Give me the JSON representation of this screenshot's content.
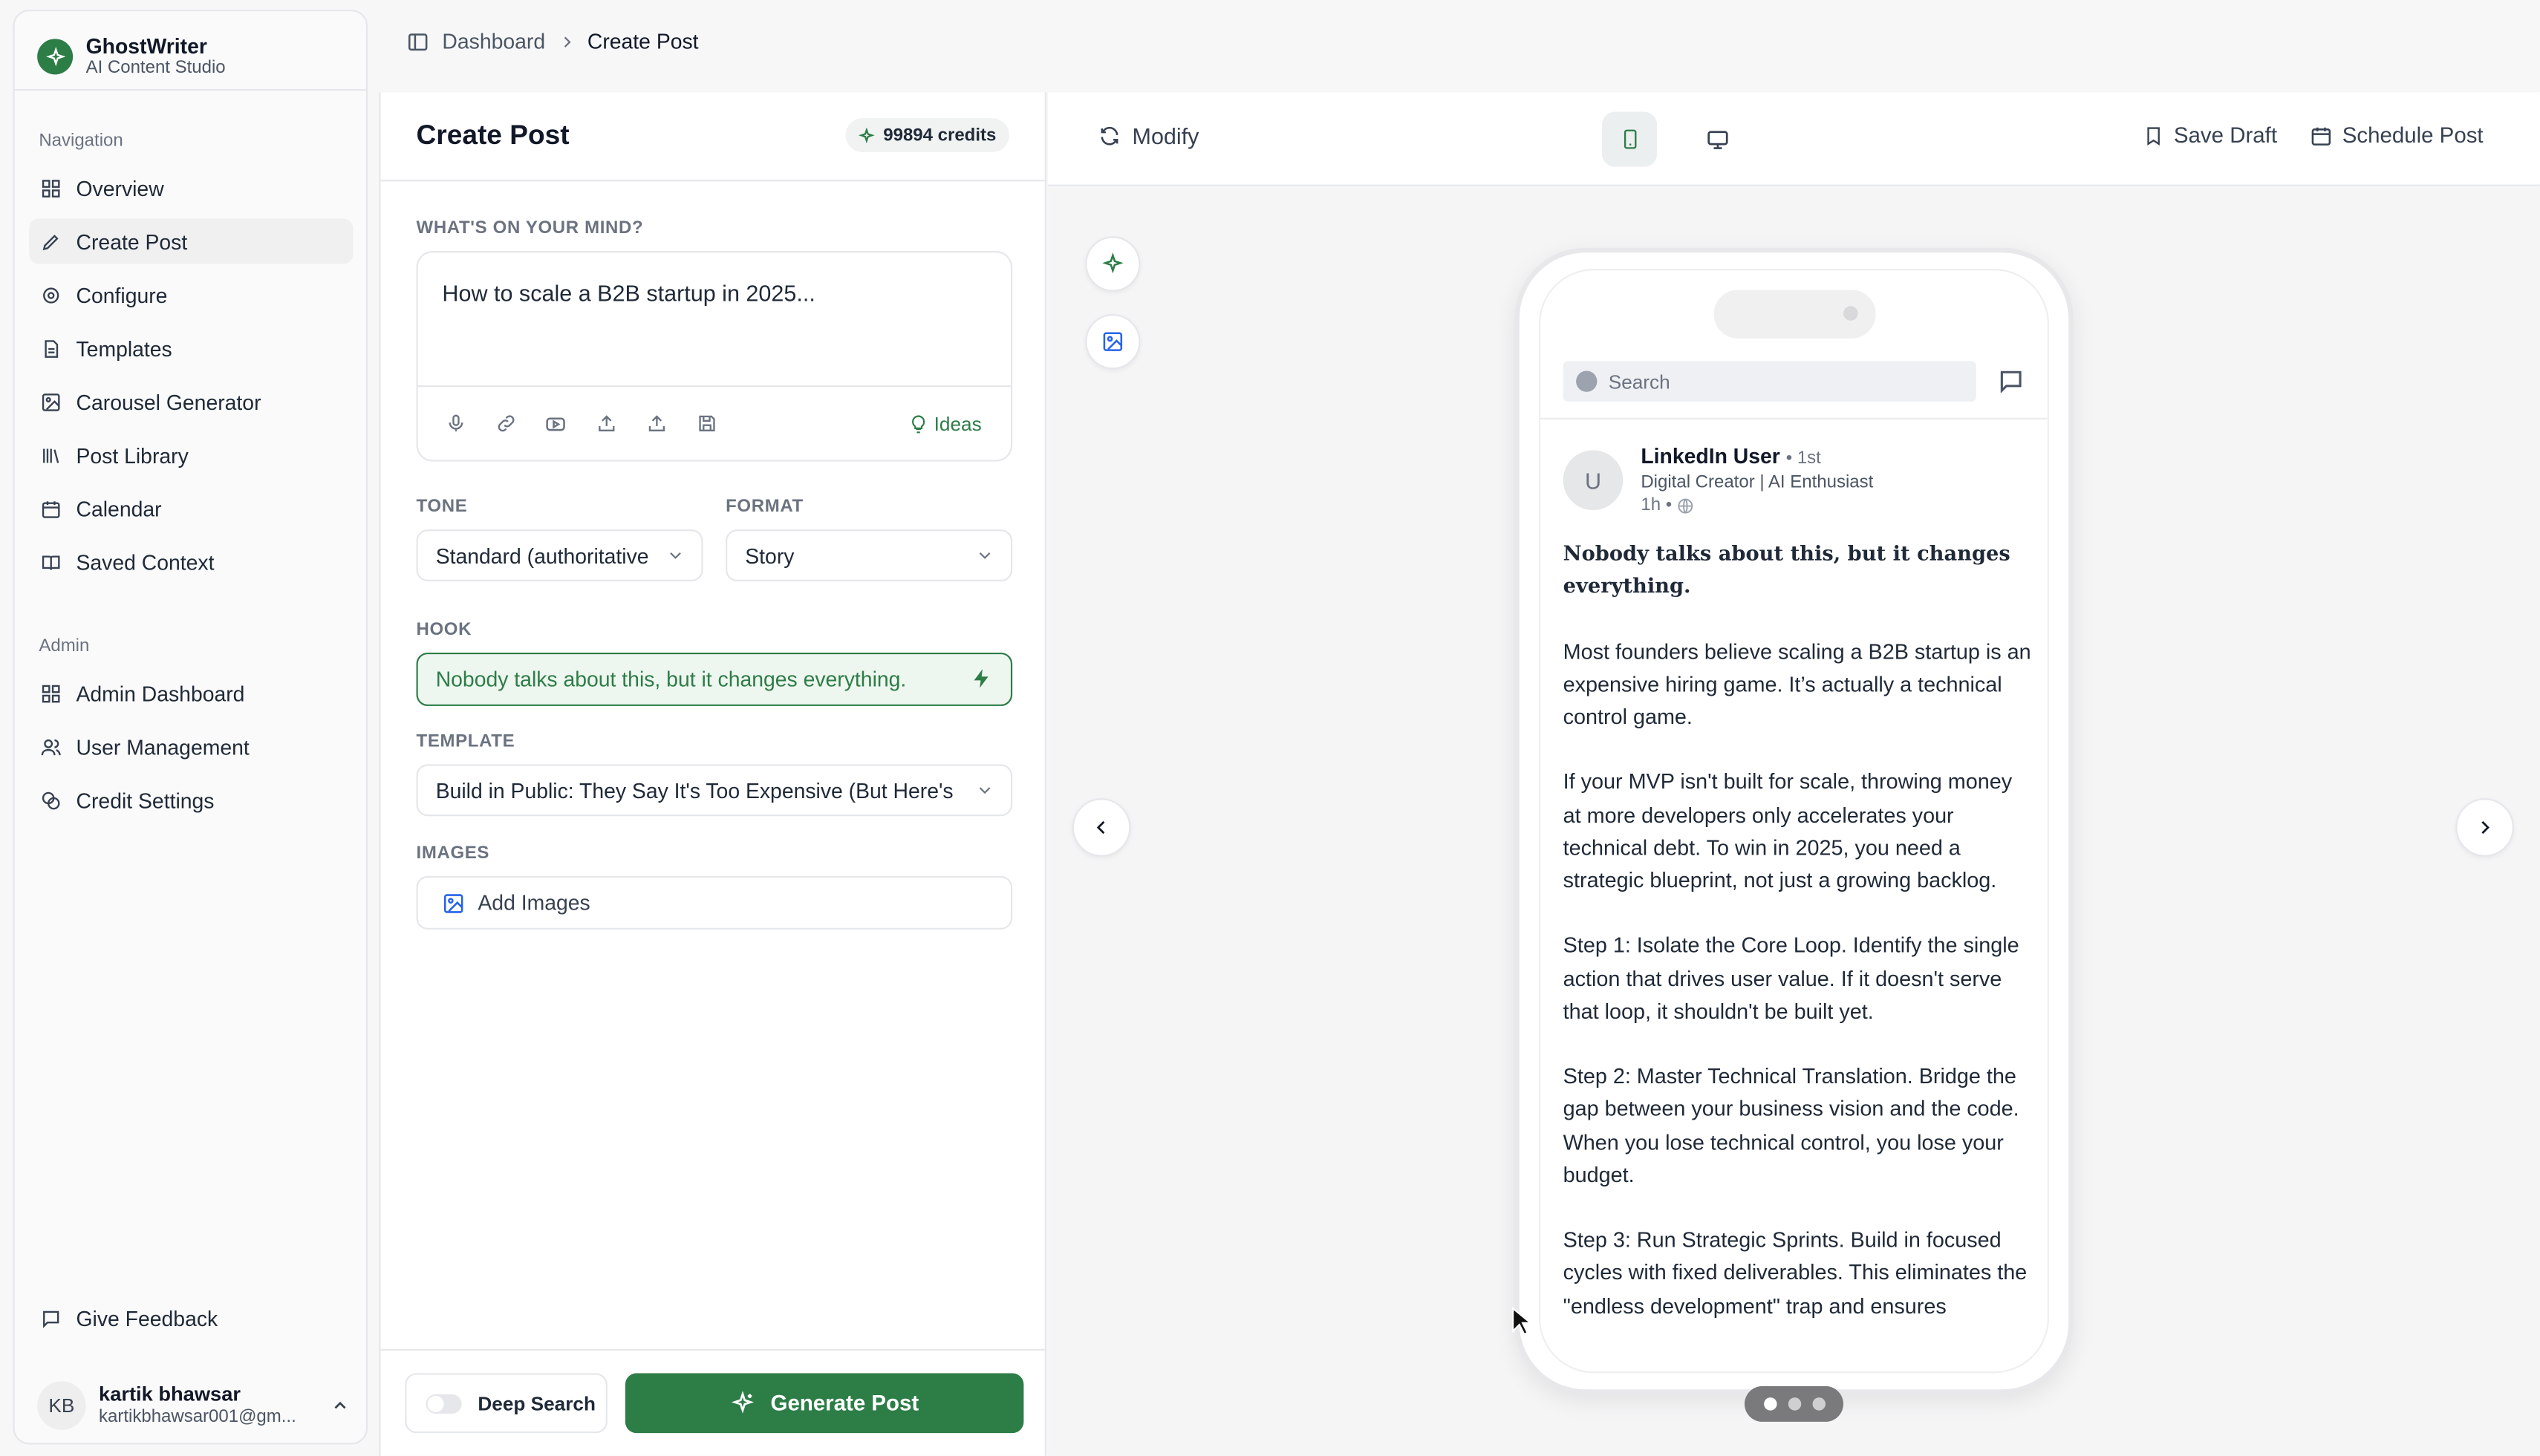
{
  "brand": {
    "title": "GhostWriter",
    "subtitle": "AI Content Studio"
  },
  "sidebar": {
    "nav_label": "Navigation",
    "items": [
      {
        "label": "Overview",
        "icon": "grid-icon"
      },
      {
        "label": "Create Post",
        "icon": "pen-icon"
      },
      {
        "label": "Configure",
        "icon": "gear-icon"
      },
      {
        "label": "Templates",
        "icon": "document-icon"
      },
      {
        "label": "Carousel Generator",
        "icon": "image-icon"
      },
      {
        "label": "Post Library",
        "icon": "library-icon"
      },
      {
        "label": "Calendar",
        "icon": "calendar-icon"
      },
      {
        "label": "Saved Context",
        "icon": "book-icon"
      }
    ],
    "admin_label": "Admin",
    "admin_items": [
      {
        "label": "Admin Dashboard",
        "icon": "grid-icon"
      },
      {
        "label": "User Management",
        "icon": "users-icon"
      },
      {
        "label": "Credit Settings",
        "icon": "coins-icon"
      }
    ],
    "feedback": "Give Feedback",
    "user": {
      "initials": "KB",
      "name": "kartik bhawsar",
      "email": "kartikbhawsar001@gm..."
    }
  },
  "breadcrumb": {
    "parent": "Dashboard",
    "current": "Create Post"
  },
  "panel": {
    "title": "Create Post",
    "credits": "99894 credits",
    "prompt_label": "WHAT'S ON YOUR MIND?",
    "prompt_text": "How to scale a B2B startup in 2025...",
    "ideas": "Ideas",
    "tone_label": "TONE",
    "tone_value": "Standard (authoritative",
    "format_label": "FORMAT",
    "format_value": "Story",
    "hook_label": "HOOK",
    "hook_value": "Nobody talks about this, but it changes everything.",
    "template_label": "TEMPLATE",
    "template_value": "Build in Public: They Say It's Too Expensive (But Here's",
    "images_label": "IMAGES",
    "add_images": "Add Images",
    "deep_search": "Deep Search",
    "generate": "Generate Post"
  },
  "preview": {
    "modify": "Modify",
    "save_draft": "Save Draft",
    "schedule": "Schedule Post",
    "search_placeholder": "Search",
    "author": "LinkedIn User",
    "degree": "• 1st",
    "headline": "Digital Creator | AI Enthusiast",
    "time": "1h •",
    "post_lead": "Nobody talks about this, but it changes everything.",
    "post_paragraphs": [
      "Most founders believe scaling a B2B startup is an expensive hiring game. It’s actually a technical control game.",
      "If your MVP isn't built for scale, throwing money at more developers only accelerates your technical debt. To win in 2025, you need a strategic blueprint, not just a growing backlog.",
      "Step 1: Isolate the Core Loop. Identify the single action that drives user value. If it doesn't serve that loop, it shouldn't be built yet.",
      "Step 2: Master Technical Translation. Bridge the gap between your business vision and the code. When you lose technical control, you lose your budget.",
      "Step 3: Run Strategic Sprints. Build in focused cycles with fixed deliverables. This eliminates the \"endless development\" trap and ensures"
    ]
  },
  "colors": {
    "accent": "#2d7d46"
  }
}
